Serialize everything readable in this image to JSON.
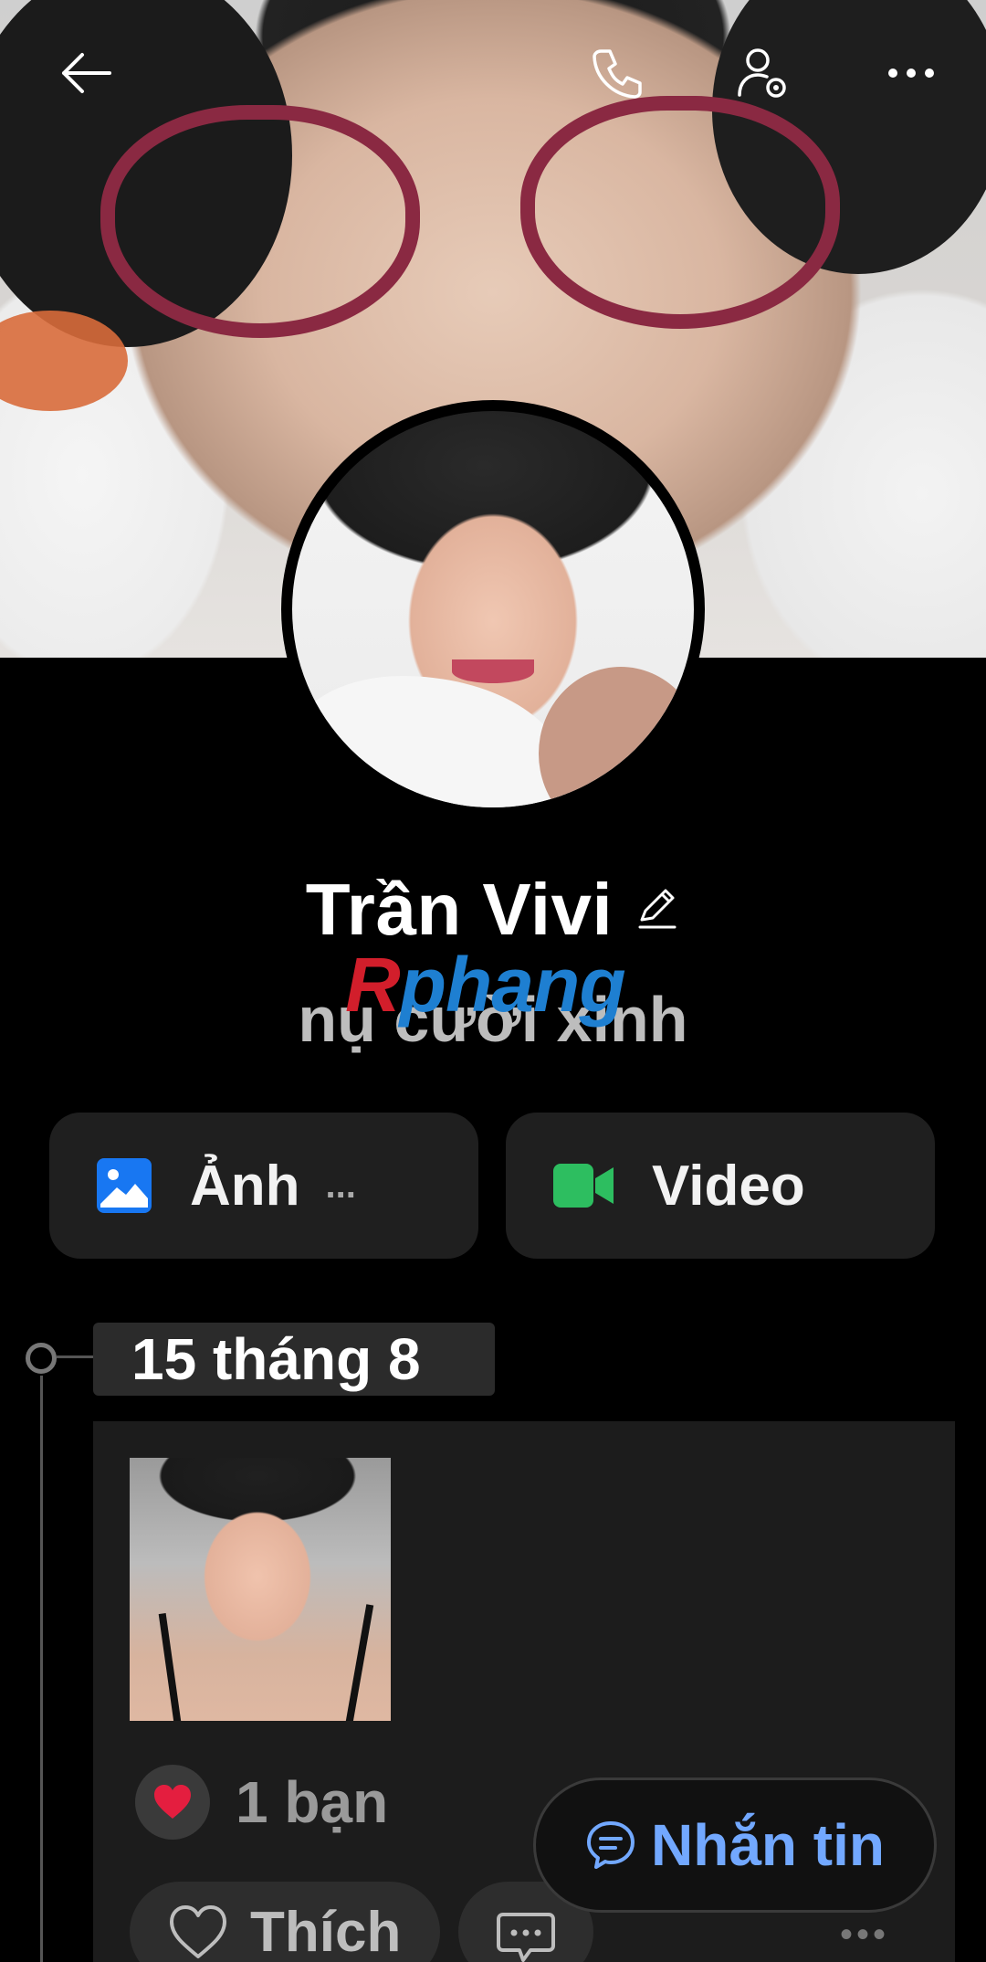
{
  "profile": {
    "name": "Trần Vivi",
    "status": "nụ cười xinh"
  },
  "watermark": {
    "first": "R",
    "rest": "phang"
  },
  "media": {
    "photos_label": "Ảnh",
    "photos_more": "...",
    "videos_label": "Video"
  },
  "timeline": {
    "date": "15 tháng 8",
    "reactions_count": "1 bạn",
    "like_label": "Thích",
    "more": "•••"
  },
  "message_button": {
    "label": "Nhắn tin"
  },
  "colors": {
    "background": "#000000",
    "accent_blue": "#72a8ff",
    "photo_icon": "#1877f2",
    "video_icon": "#2dbe60",
    "heart": "#e41e3f"
  },
  "icons": [
    "back-arrow-icon",
    "phone-icon",
    "user-settings-icon",
    "more-icon",
    "edit-pencil-icon",
    "photo-icon",
    "video-camera-icon",
    "heart-icon",
    "like-heart-icon",
    "comment-icon",
    "message-bubble-icon"
  ]
}
